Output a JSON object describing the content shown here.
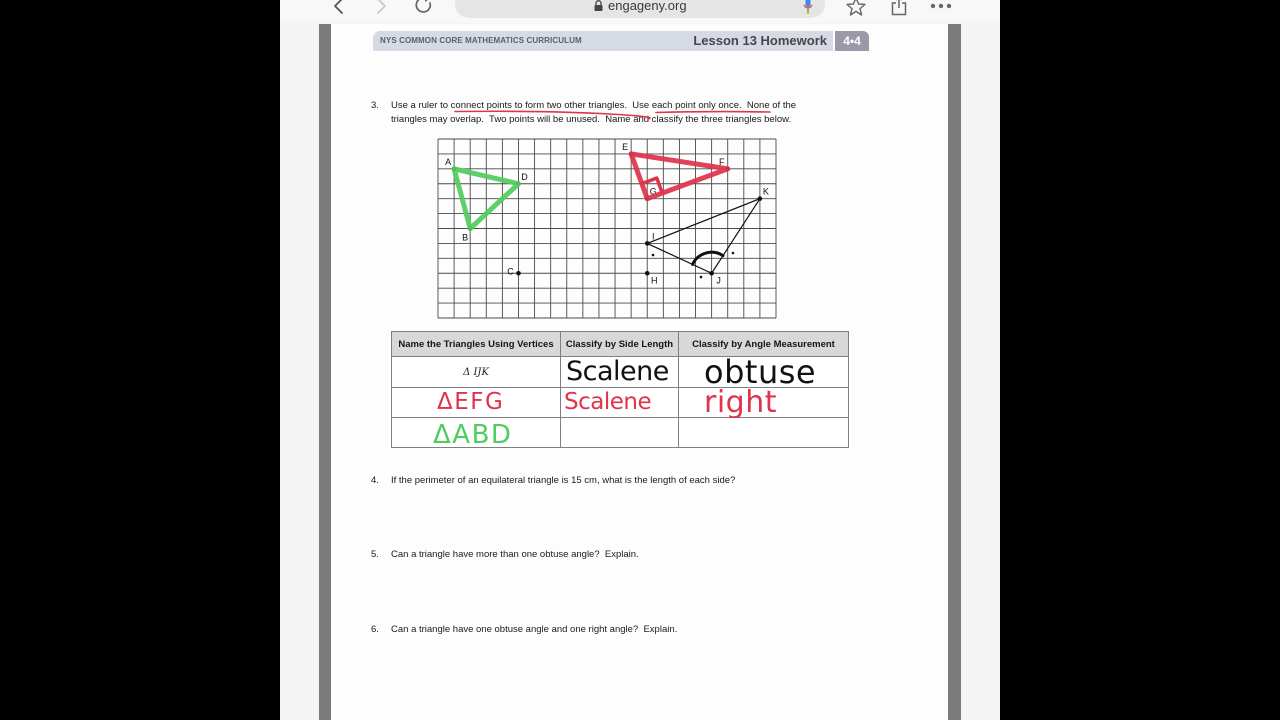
{
  "browser": {
    "url": "engageny.org",
    "icons": {
      "back": "chevron-left-icon",
      "forward": "chevron-right-icon",
      "reload": "reload-icon",
      "lock": "lock-icon",
      "microphone": "microphone-icon",
      "bookmark": "star-icon",
      "share": "share-icon",
      "more": "ellipsis-icon"
    }
  },
  "header": {
    "curriculum": "NYS COMMON CORE MATHEMATICS CURRICULUM",
    "lesson": "Lesson 13 Homework",
    "badge": "4•4"
  },
  "question3": {
    "number": "3.",
    "lines": [
      "Use a ruler to connect points to form two other triangles.  Use each point only once.  None of the",
      "triangles may overlap.  Two points will be unused.  Name and classify the three triangles below."
    ],
    "annotations": {
      "underlined_phrases": [
        "connect points to form two other triangles",
        "Use each point only once"
      ],
      "color": "#e0344c"
    }
  },
  "grid": {
    "columns": 21,
    "rows": 12,
    "points": [
      {
        "label": "A",
        "col": 1,
        "row": 2,
        "label_side": "top-left"
      },
      {
        "label": "B",
        "col": 2,
        "row": 6,
        "label_side": "bottom"
      },
      {
        "label": "C",
        "col": 5,
        "row": 9,
        "label_side": "left"
      },
      {
        "label": "D",
        "col": 5,
        "row": 3,
        "label_side": "top-right"
      },
      {
        "label": "E",
        "col": 12,
        "row": 1,
        "label_side": "top-left"
      },
      {
        "label": "F",
        "col": 18,
        "row": 2,
        "label_side": "top-left"
      },
      {
        "label": "G",
        "col": 13,
        "row": 4,
        "label_side": "top-right"
      },
      {
        "label": "H",
        "col": 13,
        "row": 9,
        "label_side": "bottom-right"
      },
      {
        "label": "I",
        "col": 13,
        "row": 7,
        "label_side": "top-right"
      },
      {
        "label": "J",
        "col": 17,
        "row": 9,
        "label_side": "bottom-right"
      },
      {
        "label": "K",
        "col": 20,
        "row": 4,
        "label_side": "top-right"
      }
    ],
    "triangles": [
      {
        "name": "IJK",
        "vertices": [
          "I",
          "J",
          "K"
        ],
        "ink": "printed",
        "color": "#111111",
        "angle_mark_at": "J"
      },
      {
        "name": "EFG",
        "vertices": [
          "E",
          "F",
          "G"
        ],
        "ink": "handwritten",
        "color": "#e0344c",
        "right_angle_at": "G"
      },
      {
        "name": "ABD",
        "vertices": [
          "A",
          "D",
          "B"
        ],
        "ink": "handwritten",
        "color": "#52cc5f"
      }
    ],
    "unused_points": [
      "C",
      "H"
    ]
  },
  "table": {
    "headers": [
      "Name the Triangles Using Vertices",
      "Classify by Side Length",
      "Classify by Angle Measurement"
    ],
    "rows": [
      {
        "name": {
          "text": "Δ IJK",
          "color": "#222222"
        },
        "side": {
          "text": "Scalene",
          "color": "#111111"
        },
        "angle": {
          "text": "obtuse",
          "color": "#111111"
        }
      },
      {
        "name": {
          "text": "ΔEFG",
          "color": "#e0344c"
        },
        "side": {
          "text": "Scalene",
          "color": "#e0344c"
        },
        "angle": {
          "text": "right",
          "color": "#e0344c"
        }
      },
      {
        "name": {
          "text": "ΔABD",
          "color": "#52cc5f"
        },
        "side": {
          "text": "",
          "color": "#111111"
        },
        "angle": {
          "text": "",
          "color": "#111111"
        }
      }
    ]
  },
  "questions": [
    {
      "number": "4.",
      "text": "If the perimeter of an equilateral triangle is 15 cm, what is the length of each side?"
    },
    {
      "number": "5.",
      "text": "Can a triangle have more than one obtuse angle?  Explain."
    },
    {
      "number": "6.",
      "text": "Can a triangle have one obtuse angle and one right angle?  Explain."
    }
  ]
}
